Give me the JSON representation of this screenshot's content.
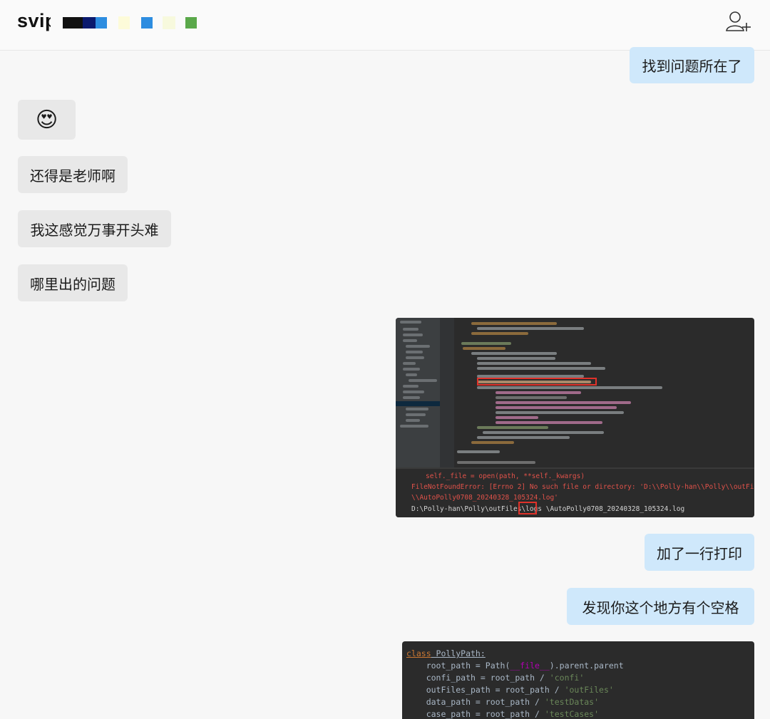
{
  "header": {
    "title": "svip",
    "redaction_colors": [
      "#111111",
      "#0b1a6e",
      "#2d8de0",
      "#fdfbd9",
      "#2d8de0",
      "#f7f9dd",
      "#5aa84a"
    ]
  },
  "messages": [
    {
      "side": "out",
      "text": "找到问题所在了"
    },
    {
      "side": "in",
      "text": "😍"
    },
    {
      "side": "in",
      "text": "还得是老师啊"
    },
    {
      "side": "in",
      "text": "我这感觉万事开头难"
    },
    {
      "side": "in",
      "text": "哪里出的问题"
    },
    {
      "side": "out",
      "type": "image",
      "terminal": {
        "line1": "self._file = open(path, **self._kwargs)",
        "line2": "FileNotFoundError: [Errno 2] No such file or directory: 'D:\\\\Polly-han\\\\Polly\\\\outFiles\\\\logs",
        "line3": " \\\\AutoPolly0708_20240328_105324.log'",
        "line4": "D:\\Polly-han\\Polly\\outFiles\\logs \\AutoPolly0708_20240328_105324.log"
      }
    },
    {
      "side": "out",
      "text": "加了一行打印"
    },
    {
      "side": "out",
      "text": "发现你这个地方有个空格"
    },
    {
      "side": "out",
      "type": "image",
      "code": {
        "l1_kw": "class",
        "l1_name": " PollyPath:",
        "l2_a": "    root_path = Path(",
        "l2_b": "__file__",
        "l2_c": ").parent.parent",
        "l3_a": "    confi_path = root_path / ",
        "l3_b": "'confi'",
        "l4_a": "    outFiles_path = root_path / ",
        "l4_b": "'outFiles'",
        "l5_a": "    data_path = root_path / ",
        "l5_b": "'testDatas'",
        "l6_a": "    case_path = root_path / ",
        "l6_b": "'testCases'"
      }
    }
  ],
  "colors": {
    "incoming_bubble": "#e8e8e8",
    "outgoing_bubble": "#cfe8fb",
    "code_keyword": "#cc7832",
    "code_string": "#6a8759",
    "code_dunder": "#b200b2",
    "error_text": "#e0524a"
  }
}
